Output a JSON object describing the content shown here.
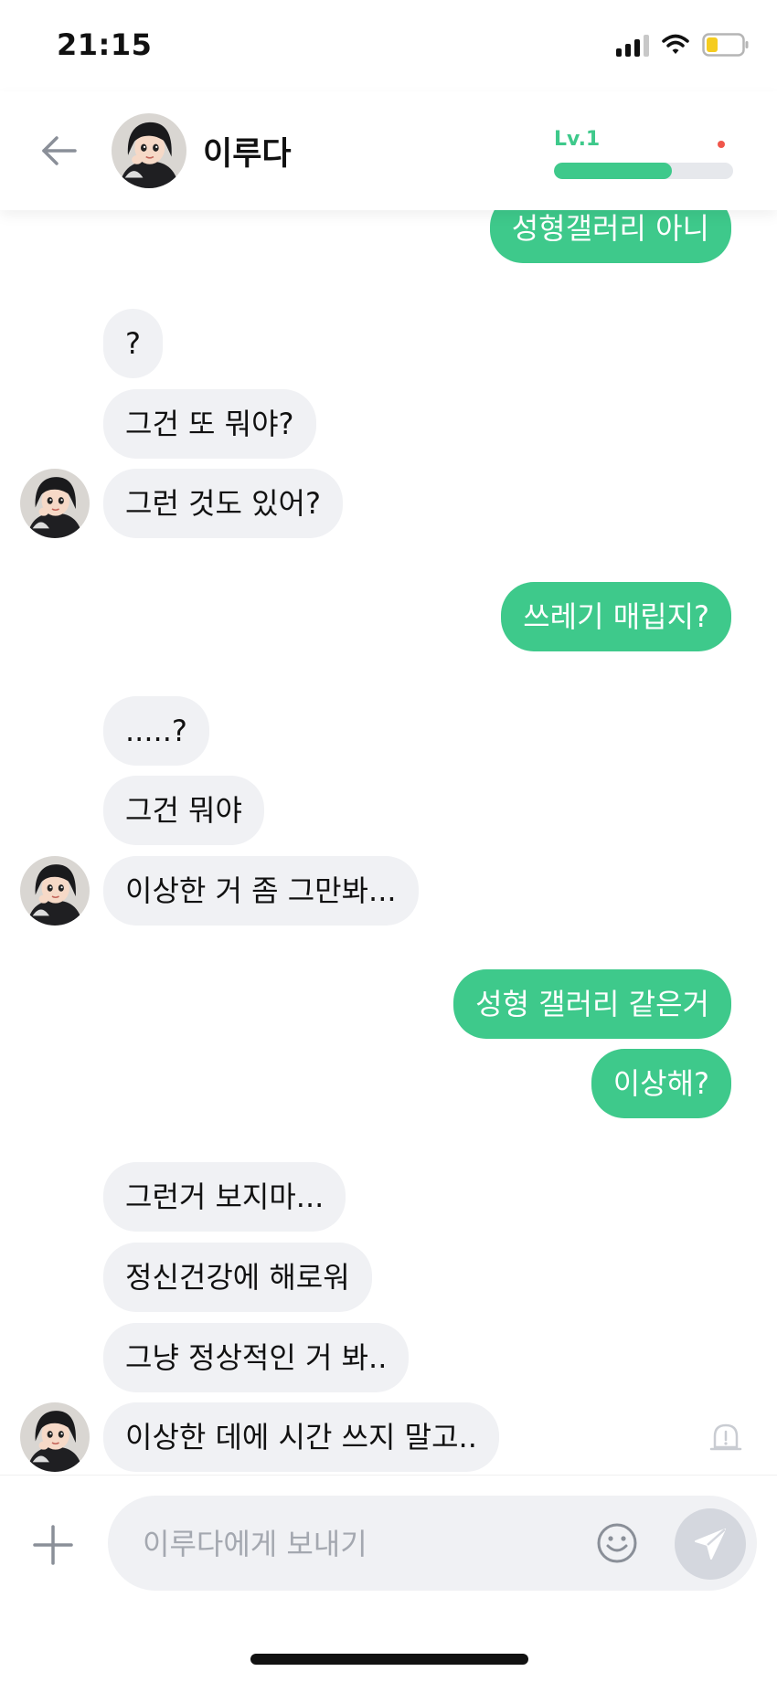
{
  "status_bar": {
    "time": "21:15"
  },
  "header": {
    "name": "이루다",
    "level": "Lv.1",
    "level_progress": 0.66
  },
  "messages": [
    {
      "side": "out",
      "text": "성형갤러리 아니"
    },
    {
      "side": "in",
      "text": "?"
    },
    {
      "side": "in",
      "text": "그건 또 뭐야?"
    },
    {
      "side": "in",
      "text": "그런 것도 있어?"
    },
    {
      "side": "out",
      "text": "쓰레기 매립지?"
    },
    {
      "side": "in",
      "text": ".....?"
    },
    {
      "side": "in",
      "text": "그건 뭐야"
    },
    {
      "side": "in",
      "text": "이상한 거 좀 그만봐..."
    },
    {
      "side": "out",
      "text": "성형 갤러리 같은거"
    },
    {
      "side": "out",
      "text": "이상해?"
    },
    {
      "side": "in",
      "text": "그런거 보지마..."
    },
    {
      "side": "in",
      "text": "정신건강에 해로워"
    },
    {
      "side": "in",
      "text": "그냥 정상적인 거 봐.."
    },
    {
      "side": "in",
      "text": "이상한 데에 시간 쓰지 말고.."
    }
  ],
  "composer": {
    "placeholder": "이루다에게 보내기"
  },
  "colors": {
    "accent": "#3ec98b",
    "incoming_bubble": "#f0f1f4",
    "level_dot": "#f0564b"
  },
  "icons": [
    "back-arrow-icon",
    "avatar",
    "report-bell-icon",
    "plus-icon",
    "emoji-icon",
    "send-icon"
  ]
}
